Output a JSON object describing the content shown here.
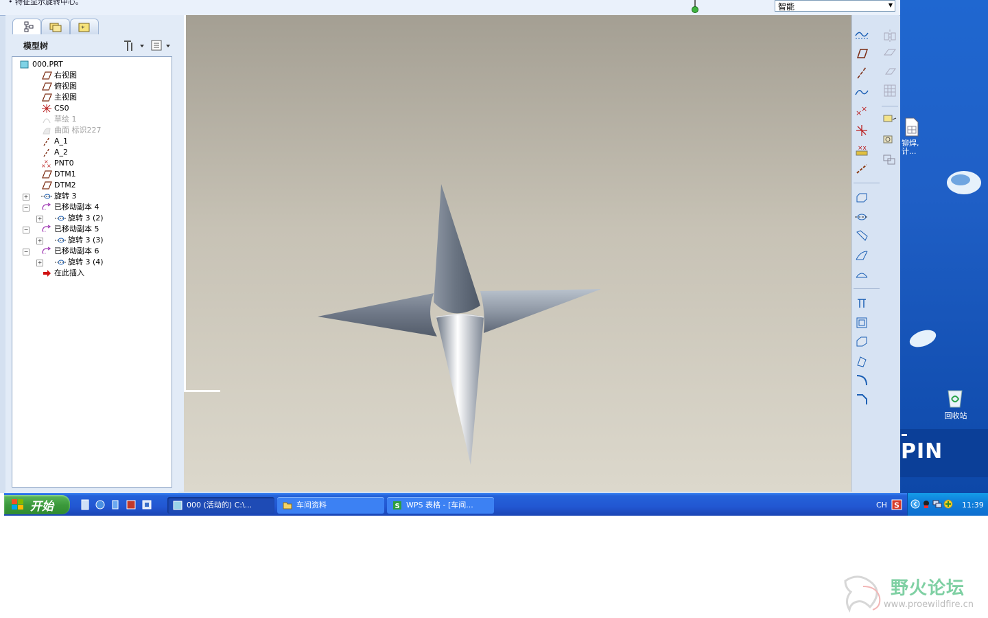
{
  "app": {
    "message": "• 特征显示旋转中心。",
    "filter": {
      "selected": "智能"
    }
  },
  "tree": {
    "tabs": [
      "model-tree-tab",
      "layers-tab",
      "favorites-tab"
    ],
    "title": "模型树",
    "items": [
      {
        "label": "000.PRT",
        "icon": "part-icon",
        "indent": 0,
        "expander": ""
      },
      {
        "label": "右视图",
        "icon": "datum-plane-icon",
        "indent": 1,
        "expander": ""
      },
      {
        "label": "俯视图",
        "icon": "datum-plane-icon",
        "indent": 1,
        "expander": ""
      },
      {
        "label": "主视图",
        "icon": "datum-plane-icon",
        "indent": 1,
        "expander": ""
      },
      {
        "label": "CS0",
        "icon": "coordinate-system-icon",
        "indent": 1,
        "expander": ""
      },
      {
        "label": "草绘 1",
        "icon": "sketch-icon",
        "indent": 1,
        "expander": "",
        "dim": true
      },
      {
        "label": "曲面 标识227",
        "icon": "surface-icon",
        "indent": 1,
        "expander": "",
        "dim": true
      },
      {
        "label": "A_1",
        "icon": "datum-axis-icon",
        "indent": 1,
        "expander": ""
      },
      {
        "label": "A_2",
        "icon": "datum-axis-icon",
        "indent": 1,
        "expander": ""
      },
      {
        "label": "PNT0",
        "icon": "datum-point-icon",
        "indent": 1,
        "expander": ""
      },
      {
        "label": "DTM1",
        "icon": "datum-plane-icon",
        "indent": 1,
        "expander": ""
      },
      {
        "label": "DTM2",
        "icon": "datum-plane-icon",
        "indent": 1,
        "expander": ""
      },
      {
        "label": "旋转 3",
        "icon": "revolve-icon",
        "indent": 1,
        "expander": "+"
      },
      {
        "label": "已移动副本 4",
        "icon": "moved-copy-icon",
        "indent": 1,
        "expander": "-"
      },
      {
        "label": "旋转 3 (2)",
        "icon": "revolve-icon",
        "indent": 2,
        "expander": "+"
      },
      {
        "label": "已移动副本 5",
        "icon": "moved-copy-icon",
        "indent": 1,
        "expander": "-"
      },
      {
        "label": "旋转 3 (3)",
        "icon": "revolve-icon",
        "indent": 2,
        "expander": "+"
      },
      {
        "label": "已移动副本 6",
        "icon": "moved-copy-icon",
        "indent": 1,
        "expander": "-"
      },
      {
        "label": "旋转 3 (4)",
        "icon": "revolve-icon",
        "indent": 2,
        "expander": "+"
      },
      {
        "label": "在此插入",
        "icon": "insert-here-arrow-icon",
        "indent": 1,
        "expander": ""
      }
    ]
  },
  "viewport": {
    "model": "four-pointed-star-part"
  },
  "desktop": {
    "doc_label_line1": "铆焊,",
    "doc_label_line2": "计...",
    "recycle_bin": "回收站",
    "wallpaper_text": "PIN"
  },
  "taskbar": {
    "start": "开始",
    "tasks": [
      {
        "label": "000 (活动的) C:\\...",
        "icon": "proe-window-icon",
        "active": true
      },
      {
        "label": "车间资料",
        "icon": "folder-icon",
        "active": false
      },
      {
        "label": "WPS 表格 - [车间...",
        "icon": "wps-sheet-icon",
        "active": false
      }
    ],
    "lang": "CH",
    "clock": "11:39"
  },
  "watermark": {
    "title": "野火论坛",
    "url": "www.proewildfire.cn"
  },
  "colors": {
    "viewport_top": "#a49f93",
    "viewport_bottom": "#dcd8cc",
    "panel": "#e2ebf7",
    "taskbar": "#2257d2",
    "desktop": "#1f5fc6"
  }
}
